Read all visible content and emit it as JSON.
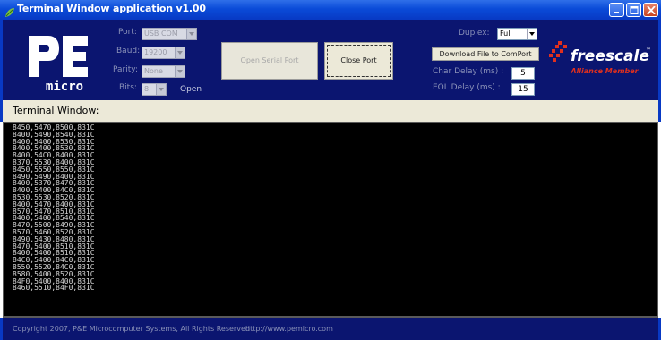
{
  "window": {
    "title": "Terminal Window application v1.00",
    "app_icon": "leaf-icon",
    "controls": [
      "minimize-icon",
      "maximize-icon",
      "close-icon"
    ]
  },
  "header": {
    "logo": {
      "top": "PE",
      "bottom": "micro"
    },
    "port": {
      "label": "Port:",
      "value": "USB COM"
    },
    "baud": {
      "label": "Baud:",
      "value": "19200"
    },
    "parity": {
      "label": "Parity:",
      "value": "None"
    },
    "bits": {
      "label": "Bits:",
      "value": "8"
    },
    "status": "Open",
    "open_button": "Open Serial Port",
    "close_button": "Close Port",
    "duplex": {
      "label": "Duplex:",
      "value": "Full"
    },
    "download_button": "Download File to ComPort",
    "char_delay": {
      "label": "Char Delay (ms) :",
      "value": "5"
    },
    "eol_delay": {
      "label": "EOL Delay (ms) :",
      "value": "15"
    },
    "brand": {
      "name": "freescale",
      "trademark": "™",
      "tagline": "Alliance Member"
    }
  },
  "terminal": {
    "label": "Terminal Window:",
    "lines": [
      "8450,5470,8500,831C",
      "8400,5490,8540,831C",
      "8400,5400,8530,831C",
      "8400,5400,8530,831C",
      "8400,54C0,8400,831C",
      "8370,5530,8400,831C",
      "8450,5550,8550,831C",
      "8490,5490,8400,831C",
      "8400,5370,8470,831C",
      "8400,5400,84C0,831C",
      "8530,5530,8520,831C",
      "8400,5470,8400,831C",
      "8570,5470,8510,831C",
      "8400,5400,8540,831C",
      "8470,5500,8490,831C",
      "8570,5460,8520,831C",
      "8490,5430,8480,831C",
      "8470,5400,8510,831C",
      "8400,5400,8510,831C",
      "84C0,5400,84C0,831C",
      "8550,5520,84C0,831C",
      "8580,5400,8520,831C",
      "84F0,5400,8400,831C",
      "8460,5510,84F0,831C"
    ]
  },
  "footer": {
    "copyright": "Copyright 2007, P&E Microcomputer Systems, All Rights Reserved",
    "url": "http://www.pemicro.com"
  },
  "colors": {
    "titlebar": "#0a4bd8",
    "panel": "#0b1570",
    "terminal_bg": "#000000",
    "terminal_text": "#d8d8d8",
    "label_text": "#8a91b8",
    "brand_red": "#e0301e"
  }
}
